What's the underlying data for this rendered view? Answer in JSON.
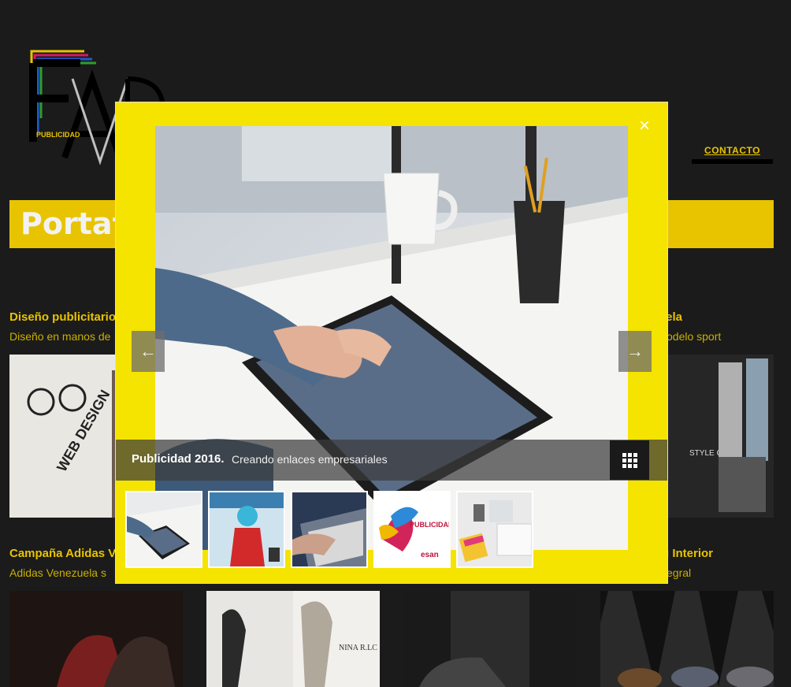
{
  "logo": {
    "name": "FAVR",
    "tagline": "PUBLICIDAD"
  },
  "nav": {
    "contact_label": "CONTACTO"
  },
  "banner": {
    "title": "Portafo"
  },
  "portfolio": {
    "row1": [
      {
        "title": "Diseño publicitario",
        "subtitle": "Diseño en manos de"
      },
      {
        "title": "",
        "subtitle": ""
      },
      {
        "title": "",
        "subtitle": ""
      },
      {
        "title": "uela",
        "subtitle": "odelo sport"
      }
    ],
    "row2": [
      {
        "title": "Campaña Adidas Ve",
        "subtitle": "Adidas Venezuela s"
      },
      {
        "title": "",
        "subtitle": ""
      },
      {
        "title": "",
        "subtitle": ""
      },
      {
        "title": "g Interior",
        "subtitle": "egral"
      }
    ],
    "thumb_text": {
      "style_guide": "STYLE GUIDE",
      "web_design": "WEB DESIGN",
      "nina": "NINA R.LC"
    }
  },
  "lightbox": {
    "close_label": "×",
    "prev_label": "←",
    "next_label": "→",
    "caption_title": "Publicidad 2016.",
    "caption_desc": "Creando enlaces empresariales",
    "thumbs": [
      "thumb-tablet",
      "thumb-magazine",
      "thumb-keyboard",
      "thumb-publicidad",
      "thumb-desk"
    ],
    "thumb_texts": {
      "publicidad": "PUBLICIDAD",
      "esan": "esan"
    }
  },
  "colors": {
    "accent": "#e8c400",
    "lightbox_bg": "#f5e300",
    "page_bg": "#1b1b1b"
  }
}
